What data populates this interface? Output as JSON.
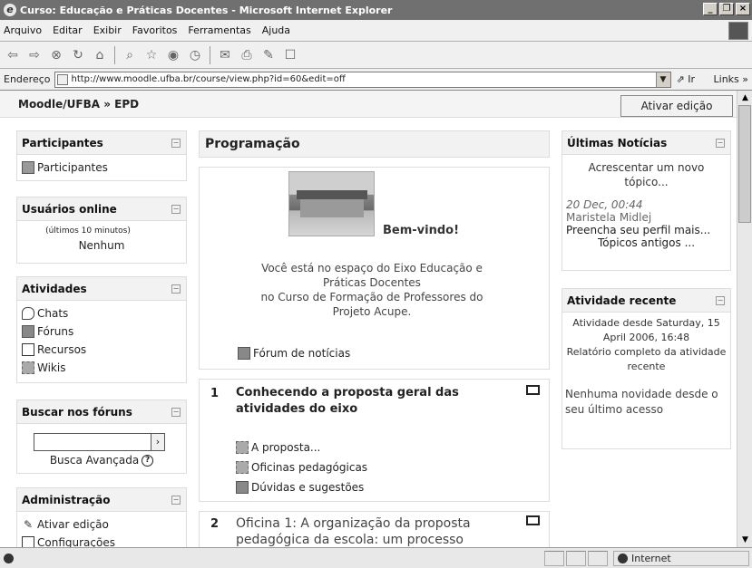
{
  "window": {
    "title": "Curso: Educação e Práticas Docentes - Microsoft Internet Explorer",
    "min": "_",
    "restore": "❐",
    "close": "×"
  },
  "menu": [
    "Arquivo",
    "Editar",
    "Exibir",
    "Favoritos",
    "Ferramentas",
    "Ajuda"
  ],
  "address": {
    "label": "Endereço",
    "url": "http://www.moodle.ufba.br/course/view.php?id=60&edit=off",
    "go": "Ir",
    "links": "Links »"
  },
  "breadcrumb": "Moodle/UFBA » EPD",
  "edit_button": "Ativar edição",
  "participants": {
    "title": "Participantes",
    "link": "Participantes"
  },
  "online": {
    "title": "Usuários online",
    "subtitle": "(últimos 10 minutos)",
    "value": "Nenhum"
  },
  "activities": {
    "title": "Atividades",
    "items": [
      "Chats",
      "Fóruns",
      "Recursos",
      "Wikis"
    ]
  },
  "search": {
    "title": "Buscar nos fóruns",
    "go": "›",
    "advanced": "Busca Avançada",
    "help": "?"
  },
  "admin": {
    "title": "Administração",
    "items": [
      "Ativar edição",
      "Configurações"
    ]
  },
  "main": {
    "title": "Programação",
    "welcome": "Bem-vindo!",
    "intro": [
      "Você está no espaço do Eixo Educação e",
      "Práticas Docentes",
      "no Curso de Formação de Professores do",
      "Projeto Acupe."
    ],
    "news_forum": "Fórum de notícias"
  },
  "topics": [
    {
      "num": "1",
      "title": "Conhecendo a proposta geral das atividades do eixo",
      "items": [
        "A proposta...",
        "Oficinas pedagógicas",
        "Dúvidas e sugestões"
      ]
    },
    {
      "num": "2",
      "title": "Oficina 1:  A organização da proposta pedagógica da escola: um processo"
    }
  ],
  "news": {
    "title": "Últimas Notícias",
    "add": "Acrescentar um novo tópico...",
    "date": "20 Dec, 00:44",
    "author": "Maristela Midlej",
    "item": "Preencha seu perfil mais...",
    "older": "Tópicos antigos ..."
  },
  "recent": {
    "title": "Atividade recente",
    "since": "Atividade desde Saturday, 15 April 2006, 16:48",
    "report": "Relatório completo da atividade recente",
    "none": "Nenhuma novidade desde o seu último acesso"
  },
  "status": {
    "zone": "Internet"
  }
}
